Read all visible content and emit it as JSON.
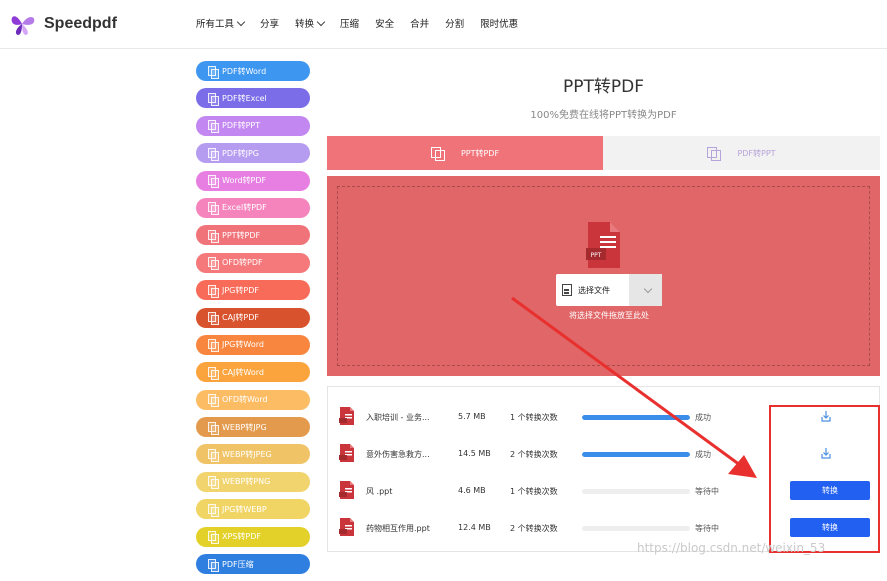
{
  "header": {
    "logo_text": "Speedpdf",
    "nav": [
      {
        "label": "所有工具",
        "has_dropdown": true
      },
      {
        "label": "分享",
        "has_dropdown": false
      },
      {
        "label": "转换",
        "has_dropdown": true
      },
      {
        "label": "压缩",
        "has_dropdown": false
      },
      {
        "label": "安全",
        "has_dropdown": false
      },
      {
        "label": "合并",
        "has_dropdown": false
      },
      {
        "label": "分割",
        "has_dropdown": false
      },
      {
        "label": "限时优惠",
        "has_dropdown": false
      }
    ]
  },
  "sidebar": {
    "items": [
      {
        "label": "PDF转Word",
        "color": "#3d97f1"
      },
      {
        "label": "PDF转Excel",
        "color": "#7b6de8"
      },
      {
        "label": "PDF转PPT",
        "color": "#c287f0"
      },
      {
        "label": "PDF转JPG",
        "color": "#b69cf0"
      },
      {
        "label": "Word转PDF",
        "color": "#e77ee2"
      },
      {
        "label": "Excel转PDF",
        "color": "#f584bd"
      },
      {
        "label": "PPT转PDF",
        "color": "#f07379"
      },
      {
        "label": "OFD转PDF",
        "color": "#f5797b"
      },
      {
        "label": "JPG转PDF",
        "color": "#f76b58"
      },
      {
        "label": "CAJ转PDF",
        "color": "#d8532d"
      },
      {
        "label": "JPG转Word",
        "color": "#f9863f"
      },
      {
        "label": "CAJ转Word",
        "color": "#fba43e"
      },
      {
        "label": "OFD转Word",
        "color": "#fcbc63"
      },
      {
        "label": "WEBP转JPG",
        "color": "#e39a4c"
      },
      {
        "label": "WEBP转JPEG",
        "color": "#f0c466"
      },
      {
        "label": "WEBP转PNG",
        "color": "#f2d46f"
      },
      {
        "label": "JPG转WEBP",
        "color": "#f0d565"
      },
      {
        "label": "XPS转PDF",
        "color": "#e3d12a"
      },
      {
        "label": "PDF压缩",
        "color": "#2e7fe0"
      }
    ]
  },
  "main": {
    "title": "PPT转PDF",
    "subtitle": "100%免费在线将PPT转换为PDF",
    "tabs": [
      {
        "label": "PPT转PDF",
        "active": true
      },
      {
        "label": "PDF转PPT",
        "active": false
      }
    ],
    "upload": {
      "choose_label": "选择文件",
      "drop_hint": "将选择文件拖放至此处",
      "icon_label": "PPT"
    },
    "files": [
      {
        "name": "入职培训 - 业务...",
        "size": "5.7 MB",
        "count": "1 个转换次数",
        "progress": 1.0,
        "status": "成功",
        "action": "download"
      },
      {
        "name": "意外伤害急救方...",
        "size": "14.5 MB",
        "count": "2 个转换次数",
        "progress": 1.0,
        "status": "成功",
        "action": "download"
      },
      {
        "name": "风 .ppt",
        "size": "4.6 MB",
        "count": "1 个转换次数",
        "progress": 0.0,
        "status": "等待中",
        "action": "convert",
        "action_label": "转换"
      },
      {
        "name": "药物相互作用.ppt",
        "size": "12.4 MB",
        "count": "2 个转换次数",
        "progress": 0.0,
        "status": "等待中",
        "action": "convert",
        "action_label": "转换"
      }
    ]
  },
  "watermark": "https://blog.csdn.net/weixin_53"
}
